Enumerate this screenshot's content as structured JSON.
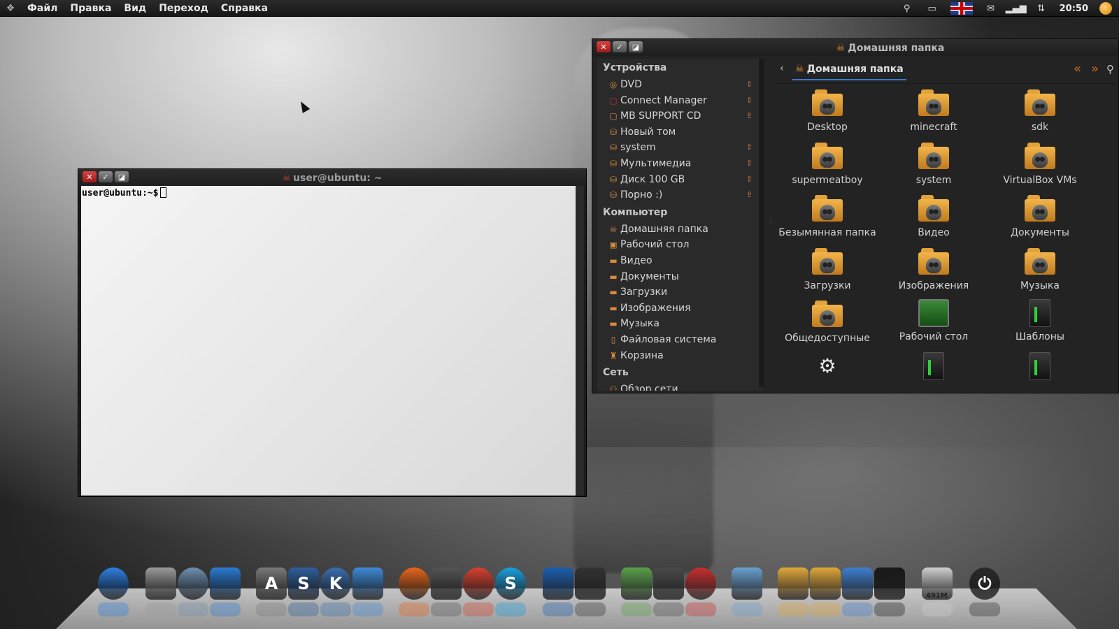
{
  "top_panel": {
    "menu": [
      "Файл",
      "Правка",
      "Вид",
      "Переход",
      "Справка"
    ],
    "clock": "20:50",
    "tray_icons": [
      "location-icon",
      "battery-icon",
      "flag-uk-icon",
      "mail-icon",
      "signal-icon",
      "network-icon"
    ]
  },
  "terminal": {
    "title": "user@ubuntu: ~",
    "prompt": "user@ubuntu:~$"
  },
  "file_manager": {
    "title": "Домашняя папка",
    "breadcrumb": "Домашняя папка",
    "sidebar": {
      "devices_header": "Устройства",
      "devices": [
        {
          "label": "DVD",
          "icon": "dvd-icon",
          "eject": true
        },
        {
          "label": "Connect Manager",
          "icon": "disc-icon",
          "eject": true
        },
        {
          "label": "MB SUPPORT CD",
          "icon": "disc-icon",
          "eject": true
        },
        {
          "label": "Новый том",
          "icon": "drive-icon",
          "eject": false
        },
        {
          "label": "system",
          "icon": "drive-icon",
          "eject": true
        },
        {
          "label": "Мультимедиа",
          "icon": "drive-icon",
          "eject": true
        },
        {
          "label": "Диск 100 GB",
          "icon": "drive-icon",
          "eject": true
        },
        {
          "label": "Порно :)",
          "icon": "drive-icon",
          "eject": true
        }
      ],
      "computer_header": "Компьютер",
      "places": [
        {
          "label": "Домашняя папка",
          "icon": "home-icon"
        },
        {
          "label": "Рабочий стол",
          "icon": "desktop-icon"
        },
        {
          "label": "Видео",
          "icon": "video-folder-icon"
        },
        {
          "label": "Документы",
          "icon": "documents-folder-icon"
        },
        {
          "label": "Загрузки",
          "icon": "downloads-folder-icon"
        },
        {
          "label": "Изображения",
          "icon": "pictures-folder-icon"
        },
        {
          "label": "Музыка",
          "icon": "music-folder-icon"
        },
        {
          "label": "Файловая система",
          "icon": "filesystem-icon"
        },
        {
          "label": "Корзина",
          "icon": "trash-icon"
        }
      ],
      "network_header": "Сеть",
      "network": [
        {
          "label": "Обзор сети",
          "icon": "network-icon"
        }
      ]
    },
    "items": [
      {
        "label": "Desktop",
        "icon": "skull-folder-icon"
      },
      {
        "label": "minecraft",
        "icon": "skull-folder-icon"
      },
      {
        "label": "sdk",
        "icon": "skull-folder-icon"
      },
      {
        "label": "supermeatboy",
        "icon": "skull-folder-icon"
      },
      {
        "label": "system",
        "icon": "skull-folder-icon"
      },
      {
        "label": "VirtualBox VMs",
        "icon": "skull-folder-icon"
      },
      {
        "label": "Безымянная папка",
        "icon": "skull-folder-icon"
      },
      {
        "label": "Видео",
        "icon": "video-folder-icon"
      },
      {
        "label": "Документы",
        "icon": "documents-folder-icon"
      },
      {
        "label": "Загрузки",
        "icon": "downloads-folder-icon"
      },
      {
        "label": "Изображения",
        "icon": "pictures-folder-icon"
      },
      {
        "label": "Музыка",
        "icon": "music-folder-icon"
      },
      {
        "label": "Общедоступные",
        "icon": "public-folder-icon"
      },
      {
        "label": "Рабочий стол",
        "icon": "desktop-monitor-icon"
      },
      {
        "label": "Шаблоны",
        "icon": "templates-icon"
      },
      {
        "label": "",
        "icon": "gear-script-icon"
      },
      {
        "label": "",
        "icon": "dark-file-icon"
      },
      {
        "label": "",
        "icon": "dark-file-icon"
      }
    ]
  },
  "dock": {
    "icons": [
      {
        "name": "apple-icon",
        "color": "#2f7fe0",
        "glyph": ""
      },
      {
        "name": "speaker-icon",
        "color": "#9a9a9a",
        "glyph": ""
      },
      {
        "name": "network-globe-icon",
        "color": "#6f8fb0",
        "glyph": ""
      },
      {
        "name": "dashboard-icon",
        "color": "#2c7bd1",
        "glyph": ""
      },
      {
        "name": "app-store-icon",
        "color": "#7a7a7a",
        "glyph": "A"
      },
      {
        "name": "skype-s-icon",
        "color": "#2e5f9a",
        "glyph": "S"
      },
      {
        "name": "k-icon",
        "color": "#3b6fb0",
        "glyph": "K"
      },
      {
        "name": "finder-icon",
        "color": "#3f8ad8",
        "glyph": ""
      },
      {
        "name": "firefox-icon",
        "color": "#e8661c",
        "glyph": ""
      },
      {
        "name": "skull-gear-icon",
        "color": "#555555",
        "glyph": ""
      },
      {
        "name": "chrome-icon",
        "color": "#d8412f",
        "glyph": ""
      },
      {
        "name": "skype-icon",
        "color": "#1aa0e0",
        "glyph": "S"
      },
      {
        "name": "butterfly-icon",
        "color": "#1c5fb0",
        "glyph": ""
      },
      {
        "name": "clapperboard-icon",
        "color": "#333333",
        "glyph": ""
      },
      {
        "name": "photos-icon",
        "color": "#5aa04a",
        "glyph": ""
      },
      {
        "name": "camera-icon",
        "color": "#4a4a4a",
        "glyph": ""
      },
      {
        "name": "flame-icon",
        "color": "#c92f2f",
        "glyph": ""
      },
      {
        "name": "virtualbox-icon",
        "color": "#6aa0d0",
        "glyph": ""
      },
      {
        "name": "folder-icon",
        "color": "#e0a73a",
        "glyph": ""
      },
      {
        "name": "folder-icon",
        "color": "#e0a73a",
        "glyph": ""
      },
      {
        "name": "finder-face-icon",
        "color": "#3f7fd0",
        "glyph": ""
      },
      {
        "name": "terminal-icon",
        "color": "#1a1a1a",
        "glyph": ""
      },
      {
        "name": "memory-icon",
        "color": "#cfcfcf",
        "glyph": ""
      },
      {
        "name": "power-icon",
        "color": "#2a2a2a",
        "glyph": "⏻"
      }
    ],
    "memory_label": "491M"
  }
}
